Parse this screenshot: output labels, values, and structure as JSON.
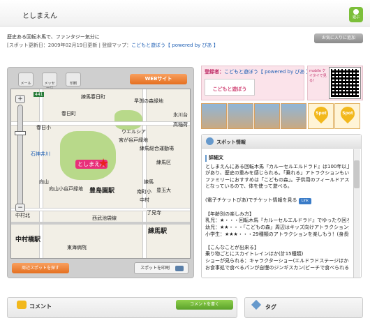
{
  "header": {
    "title": "としまえん",
    "icon_label": "遊ぶ"
  },
  "intro": "歴史ある回転木馬で、ファンタジー気分に",
  "meta": {
    "prefix": "[スポット更新日：2009年02月19日更新 | 登録マップ：",
    "map_link": "こどもと遊ぼう【 powered by ぴあ 】"
  },
  "favorite_button": "お気に入りに追加",
  "map_panel": {
    "tools": [
      "メール",
      "メッセージ",
      "印刷"
    ],
    "web_button": "WEBサイト",
    "zoom": {
      "plus": "+",
      "minus": "−"
    },
    "labels": [
      "練馬春日町",
      "早渕の森緑地",
      "高稲荷",
      "氷川台",
      "練馬区",
      "豊玉大",
      "春日小",
      "春日町",
      "ウエルシア",
      "宮が谷戸緑地",
      "石神井川",
      "練馬総合運動場",
      "向山",
      "向山分園",
      "向山小谷戸緑地",
      "豊島園駅",
      "練馬",
      "南町小",
      "中村",
      "中村小",
      "中村橋駅",
      "中村北",
      "練馬駅",
      "了見寺",
      "練馬上",
      "東海病院",
      "西武池袋線",
      "豊玉上"
    ],
    "road_badges": [
      "441",
      "441",
      "40"
    ],
    "pin_label": "としまえん",
    "nearby_button": "周辺スポットを探す",
    "print_button": "スポットを印刷"
  },
  "registrant": {
    "label": "登録者：",
    "name": "こどもと遊ぼう【 powered by ぴあ 】",
    "banner": "こどもと遊ぼう",
    "mobile_label": "mobile ケイタイで見る！"
  },
  "photos": {
    "thumbnail_count": 4,
    "spot_placeholder": "Spot",
    "spot_count": 3
  },
  "spot_info": {
    "title": "スポット情報",
    "subtitle": "詳細文",
    "paragraphs": [
      "としまえんにある回転木馬『カルーセルエルドラド』は100年以上の歴史",
      "があり、歴史の重みを感じられる。「乗れる」アトラクションもいいが、",
      "ファミリーにおすすめは「こどもの森」。子供用のフィールドアスレチック",
      "となっているので、体を使って遊べる。"
    ],
    "ticket_text": "(電子チケットぴあ)でチケット情報を見る",
    "link_badge": "Link",
    "section_fun": "【年齢別の楽しみ方】",
    "fun_items": [
      "乳児：★・・・回転木馬『カルーセルエルドラド』でゆったり回ろう",
      "幼児：★★・・・「こどもの森」周辺はキッズ向けアトラクションがぞろぞろ",
      "小学生：★★★・・・29種類のアトラクションを楽しもう！(身長制限あり)"
    ],
    "section_shops": "【こんなことが出来る】",
    "shop_items": [
      "乗り物ごとにスカイトレインほか(計15種類)",
      "ショーが見られる：キャラクターショー(エルドラドステージほか、無料)",
      "お食事処で食べるパンが自慢のジンギスカン(ビーチで食べられる)"
    ]
  },
  "comments": {
    "title": "コメント",
    "write_button": "コメントを書く"
  },
  "tags": {
    "title": "タグ"
  }
}
